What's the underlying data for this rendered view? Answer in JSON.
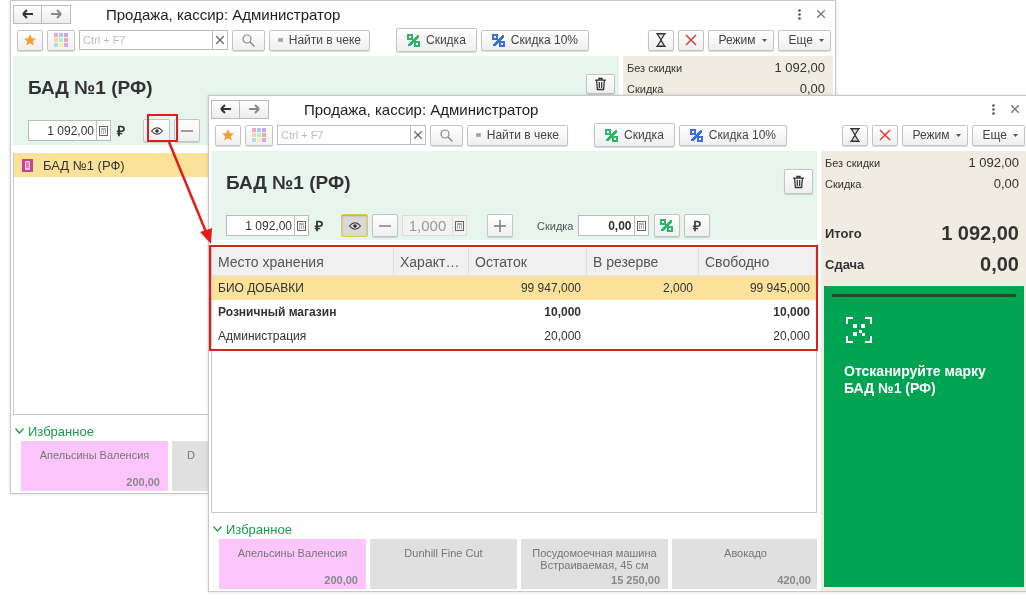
{
  "windows": [
    {
      "title": "Продажа, кассир: Администратор",
      "toolbar_left": [
        {
          "kind": "favorite"
        },
        {
          "kind": "palette"
        },
        {
          "kind": "search_field",
          "placeholder": "Ctrl + F7"
        },
        {
          "kind": "search"
        },
        {
          "kind": "find",
          "label": "Найти в чеке"
        },
        {
          "kind": "discount",
          "label": "Скидка",
          "color": "#2fb56b"
        },
        {
          "kind": "discount",
          "label": "Скидка 10%",
          "color": "#3a6fe0"
        }
      ],
      "toolbar_right": [
        {
          "kind": "timer"
        },
        {
          "kind": "cancel"
        },
        {
          "kind": "menu",
          "label": "Режим"
        },
        {
          "kind": "menu",
          "label": "Еще"
        }
      ],
      "item_title": "БАД №1 (РФ)",
      "controls": [
        {
          "kind": "amount",
          "value": "1 092,00"
        },
        {
          "kind": "currency",
          "text": "₽"
        },
        {
          "kind": "view",
          "selected": false
        },
        {
          "kind": "minus"
        }
      ],
      "lines": [
        {
          "name": "БАД №1 (РФ)",
          "selected": true
        }
      ],
      "favorites_title": "Избранное",
      "favorites": [
        {
          "name": "Апельсины Валенсия",
          "price": "200,00",
          "color": "#fcc6fc"
        },
        {
          "name": "D",
          "color": "#e0e0e0"
        }
      ],
      "totals": [
        {
          "kind": "normal",
          "label": "Без скидки",
          "value": "1 092,00"
        },
        {
          "kind": "normal",
          "label": "Скидка",
          "value": "0,00"
        }
      ]
    },
    {
      "title": "Продажа, кассир: Администратор",
      "toolbar_left": [
        {
          "kind": "favorite"
        },
        {
          "kind": "palette"
        },
        {
          "kind": "search_field",
          "placeholder": "Ctrl + F7"
        },
        {
          "kind": "search"
        },
        {
          "kind": "find",
          "label": "Найти в чеке"
        },
        {
          "kind": "discount",
          "label": "Скидка",
          "color": "#2fb56b"
        },
        {
          "kind": "discount",
          "label": "Скидка 10%",
          "color": "#3a6fe0"
        }
      ],
      "toolbar_right": [
        {
          "kind": "timer"
        },
        {
          "kind": "cancel"
        },
        {
          "kind": "menu",
          "label": "Режим"
        },
        {
          "kind": "menu",
          "label": "Еще"
        }
      ],
      "item_title": "БАД №1 (РФ)",
      "controls": [
        {
          "kind": "amount",
          "value": "1 092,00"
        },
        {
          "kind": "currency",
          "text": "₽"
        },
        {
          "kind": "view",
          "selected": true
        },
        {
          "kind": "minus"
        },
        {
          "kind": "quantity",
          "value": "1,000",
          "disabled": true
        },
        {
          "kind": "plus"
        },
        {
          "kind": "label",
          "text": "Скидка"
        },
        {
          "kind": "discount_amount",
          "value": "0,00"
        },
        {
          "kind": "percent"
        },
        {
          "kind": "currency_button",
          "text": "₽"
        }
      ],
      "stock": {
        "columns": [
          "Место хранения",
          "Характ…",
          "Остаток",
          "В резерве",
          "Свободно"
        ],
        "rows": [
          {
            "kind": "location",
            "selected": true,
            "place": "БИО ДОБАВКИ",
            "remaining": "99 947,000",
            "reserved": "2,000",
            "free": "99 945,000"
          },
          {
            "kind": "store",
            "selected": false,
            "place": "Розничный магазин",
            "remaining": "10,000",
            "free": "10,000"
          },
          {
            "kind": "location",
            "selected": false,
            "place": "Администрация",
            "remaining": "20,000",
            "free": "20,000"
          }
        ]
      },
      "favorites_title": "Избранное",
      "favorites": [
        {
          "name": "Апельсины Валенсия",
          "price": "200,00",
          "color": "#fcc6fc"
        },
        {
          "name": "Dunhill Fine Cut",
          "color": "#e0e0e0"
        },
        {
          "name": "Посудомоечная машина Встраиваемая, 45 см",
          "price": "15 250,00",
          "color": "#e0e0e0"
        },
        {
          "name": "Авокадо",
          "price": "420,00",
          "color": "#e0e0e0"
        }
      ],
      "totals": [
        {
          "kind": "normal",
          "label": "Без скидки",
          "value": "1 092,00"
        },
        {
          "kind": "normal",
          "label": "Скидка",
          "value": "0,00"
        },
        {
          "kind": "total",
          "label": "Итого",
          "value": "1 092,00"
        },
        {
          "kind": "total",
          "label": "Сдача",
          "value": "0,00"
        }
      ],
      "scan": {
        "message": "Отсканируйте марку БАД №1 (РФ)"
      }
    }
  ]
}
